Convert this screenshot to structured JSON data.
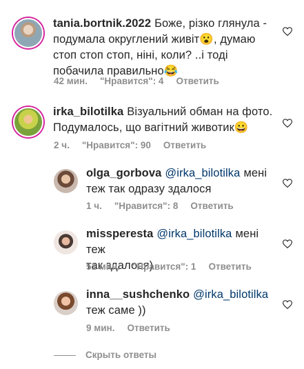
{
  "comments": [
    {
      "username": "tania.bortnik.2022",
      "mention": "",
      "line1": "Боже, різко глянула -",
      "line2": "подумала округлений живіт😮, думаю",
      "line3": "стоп стоп стоп, ніні, коли? ..і тоді",
      "line4": "побачила правильно😂",
      "time": "42 мин.",
      "likes": "\"Нравится\": 4",
      "reply": "Ответить"
    },
    {
      "username": "irka_bilotilka",
      "mention": "",
      "line1": "Візуальний обман на фото.",
      "line2": "Подумалось, що вагітний животик😀",
      "time": "2 ч.",
      "likes": "\"Нравится\": 90",
      "reply": "Ответить"
    },
    {
      "username": "olga_gorbova",
      "mention": "@irka_bilotilka",
      "line1": "мені",
      "line2": "теж так одразу здалося",
      "time": "1 ч.",
      "likes": "\"Нравится\": 8",
      "reply": "Ответить"
    },
    {
      "username": "missperesta",
      "mention": "@irka_bilotilka",
      "line1": "мені теж",
      "line2": "так здалося)",
      "time": "51 мин.",
      "likes": "\"Нравится\": 1",
      "reply": "Ответить"
    },
    {
      "username": "inna__sushchenko",
      "mention": "@irka_bilotilka",
      "line1": "",
      "line2": "теж саме ))",
      "time": "9 мин.",
      "likes": "",
      "reply": "Ответить"
    }
  ],
  "hide_replies": "Скрыть ответы",
  "icons": {
    "like": "heart-outline-icon"
  },
  "colors": {
    "mention": "#00376b",
    "meta": "#8e8e8e",
    "story_ring": "#d6249f"
  }
}
